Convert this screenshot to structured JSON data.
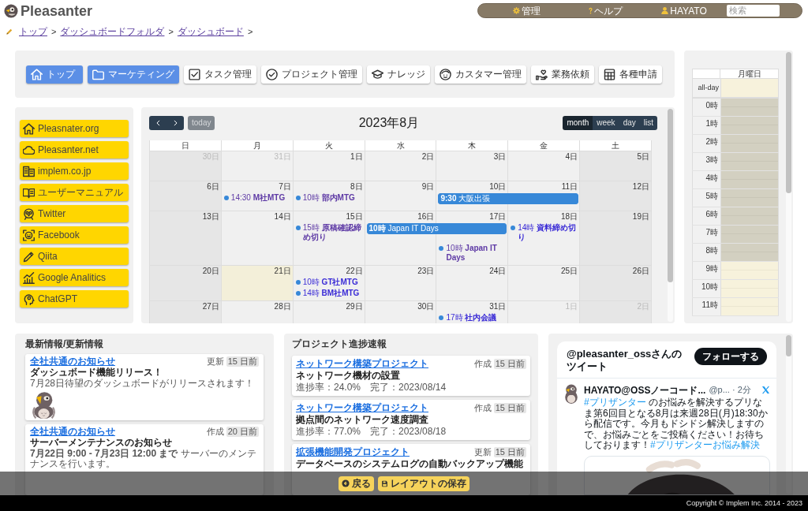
{
  "header": {
    "logo": "Pleasanter",
    "menu": [
      {
        "kind": "admin",
        "label": "管理"
      },
      {
        "kind": "help",
        "label": "ヘルプ"
      },
      {
        "kind": "user",
        "label": "HAYATO"
      }
    ],
    "search": {
      "placeholder": "検索"
    }
  },
  "breadcrumb": [
    {
      "label": "トップ",
      "separator": ">"
    },
    {
      "label": "ダッシュボードフォルダ",
      "separator": ">"
    },
    {
      "label": "ダッシュボード",
      "separator": ">"
    }
  ],
  "nav_buttons": [
    {
      "kind": "home",
      "label": "トップ",
      "highlighted": true
    },
    {
      "kind": "folder",
      "label": "マーケティング",
      "highlighted": true
    },
    {
      "kind": "task",
      "label": "タスク管理",
      "highlighted": false
    },
    {
      "kind": "project",
      "label": "プロジェクト管理",
      "highlighted": false
    },
    {
      "kind": "knowledge",
      "label": "ナレッジ",
      "highlighted": false
    },
    {
      "kind": "customer",
      "label": "カスタマー管理",
      "highlighted": false
    },
    {
      "kind": "request",
      "label": "業務依頼",
      "highlighted": false
    },
    {
      "kind": "application",
      "label": "各種申請",
      "highlighted": false
    }
  ],
  "quick_links": [
    {
      "kind": "home",
      "label": "Pleasnater.org"
    },
    {
      "kind": "cloud",
      "label": "Pleasanter.net"
    },
    {
      "kind": "company",
      "label": "implem.co.jp"
    },
    {
      "kind": "manual",
      "label": "ユーザーマニュアル"
    },
    {
      "kind": "twitter",
      "label": "Twitter"
    },
    {
      "kind": "facebook",
      "label": "Facebook"
    },
    {
      "kind": "qiita",
      "label": "Qiita"
    },
    {
      "kind": "analytics",
      "label": "Google Analitics"
    },
    {
      "kind": "chatgpt",
      "label": "ChatGPT"
    }
  ],
  "calendar": {
    "today_button": {
      "label": "today",
      "disabled": true
    },
    "title": "2023年8月",
    "views": [
      {
        "label": "month",
        "selected": true
      },
      {
        "label": "week",
        "selected": false
      },
      {
        "label": "day",
        "selected": false
      },
      {
        "label": "list",
        "selected": false
      }
    ],
    "weekdays": [
      "日",
      "月",
      "火",
      "水",
      "木",
      "金",
      "土"
    ],
    "weeks": [
      {
        "days": [
          {
            "date": "30日",
            "other_month": true,
            "today": false
          },
          {
            "date": "31日",
            "other_month": true,
            "today": false
          },
          {
            "date": "1日",
            "other_month": false,
            "today": false
          },
          {
            "date": "2日",
            "other_month": false,
            "today": false
          },
          {
            "date": "3日",
            "other_month": false,
            "today": false
          },
          {
            "date": "4日",
            "other_month": false,
            "today": false
          },
          {
            "date": "5日",
            "other_month": false,
            "today": false
          }
        ]
      },
      {
        "days": [
          {
            "date": "6日",
            "other_month": false,
            "today": false
          },
          {
            "date": "7日",
            "other_month": false,
            "today": false,
            "events": [
              {
                "kind": "dot",
                "label": "14:30 **M社MTG**",
                "visited": true
              }
            ]
          },
          {
            "date": "8日",
            "other_month": false,
            "today": false,
            "events": [
              {
                "kind": "dot",
                "label": "10時 **部内MTG**",
                "visited": true
              }
            ]
          },
          {
            "date": "9日",
            "other_month": false,
            "today": false
          },
          {
            "date": "10日",
            "other_month": false,
            "today": false,
            "events": [
              {
                "kind": "bar",
                "label": "**9:30** 大阪出張",
                "continues_next_day": true
              }
            ]
          },
          {
            "date": "11日",
            "other_month": false,
            "today": false
          },
          {
            "date": "12日",
            "other_month": false,
            "today": false
          }
        ]
      },
      {
        "days": [
          {
            "date": "13日",
            "other_month": false,
            "today": false
          },
          {
            "date": "14日",
            "other_month": false,
            "today": false
          },
          {
            "date": "15日",
            "other_month": false,
            "today": false,
            "events": [
              {
                "kind": "dot",
                "label": "15時 **原稿確認締め切り**",
                "visited": true
              }
            ]
          },
          {
            "date": "16日",
            "other_month": false,
            "today": false,
            "events": [
              {
                "kind": "bar",
                "label": "**10時** Japan IT Days",
                "continues_next_day": true
              }
            ]
          },
          {
            "date": "17日",
            "other_month": false,
            "today": false,
            "events": [
              {
                "kind": "dot",
                "label": "10時 **Japan IT Days**",
                "visited": true
              }
            ]
          },
          {
            "date": "18日",
            "other_month": false,
            "today": false,
            "events": [
              {
                "kind": "dot",
                "label": "14時 **資料締め切り**",
                "visited": false
              }
            ]
          },
          {
            "date": "19日",
            "other_month": false,
            "today": false
          }
        ]
      },
      {
        "days": [
          {
            "date": "20日",
            "other_month": false,
            "today": false
          },
          {
            "date": "21日",
            "other_month": false,
            "today": true
          },
          {
            "date": "22日",
            "other_month": false,
            "today": false,
            "events": [
              {
                "kind": "dot",
                "label": "10時 **GT社MTG**",
                "visited": false
              },
              {
                "kind": "dot",
                "label": "14時 **BM社MTG**",
                "visited": false
              }
            ]
          },
          {
            "date": "23日",
            "other_month": false,
            "today": false
          },
          {
            "date": "24日",
            "other_month": false,
            "today": false
          },
          {
            "date": "25日",
            "other_month": false,
            "today": false
          },
          {
            "date": "26日",
            "other_month": false,
            "today": false
          }
        ]
      },
      {
        "days": [
          {
            "date": "27日",
            "other_month": false,
            "today": false
          },
          {
            "date": "28日",
            "other_month": false,
            "today": false
          },
          {
            "date": "29日",
            "other_month": false,
            "today": false
          },
          {
            "date": "30日",
            "other_month": false,
            "today": false
          },
          {
            "date": "31日",
            "other_month": false,
            "today": false,
            "events": [
              {
                "kind": "dot",
                "label": "17時 **社内会議**",
                "visited": false
              }
            ]
          },
          {
            "date": "1日",
            "other_month": true,
            "today": false
          },
          {
            "date": "2日",
            "other_month": true,
            "today": false
          }
        ]
      }
    ]
  },
  "week_view": {
    "column": "月曜日",
    "all_day_label": "all-day",
    "hours": [
      {
        "label": "0時",
        "business_hours": false
      },
      {
        "label": "1時",
        "business_hours": false
      },
      {
        "label": "2時",
        "business_hours": false
      },
      {
        "label": "3時",
        "business_hours": false
      },
      {
        "label": "4時",
        "business_hours": false
      },
      {
        "label": "5時",
        "business_hours": false
      },
      {
        "label": "6時",
        "business_hours": false
      },
      {
        "label": "7時",
        "business_hours": false
      },
      {
        "label": "8時",
        "business_hours": false
      },
      {
        "label": "9時",
        "business_hours": true
      },
      {
        "label": "10時",
        "business_hours": true
      },
      {
        "label": "11時",
        "business_hours": true
      }
    ]
  },
  "news": {
    "title": "最新情報/更新情報",
    "items": [
      {
        "category": "全社共通のお知らせ",
        "meta_label": "更新",
        "age": "15 日前",
        "title": "ダッシュボード機能リリース！",
        "body": "7月28日待望のダッシュボードがリリースされます！",
        "image": true
      },
      {
        "category": "全社共通のお知らせ",
        "meta_label": "作成",
        "age": "20 日前",
        "title": "サーバーメンテナンスのお知らせ",
        "body": "**7月22日 9:00 - 7月23日 12:00 まで** サーバーのメンテナンスを行います。"
      }
    ]
  },
  "progress": {
    "title": "プロジェクト進捗速報",
    "items": [
      {
        "project": "ネットワーク構築プロジェクト",
        "meta_label": "作成",
        "age": "15 日前",
        "title": "ネットワーク機材の設置",
        "status": "進捗率：24.0%　完了：2023/08/14"
      },
      {
        "project": "ネットワーク構築プロジェクト",
        "meta_label": "作成",
        "age": "15 日前",
        "title": "拠点間のネットワーク速度調査",
        "status": "進捗率：77.0%　完了：2023/08/18"
      },
      {
        "project": "拡張機能開発プロジェクト",
        "meta_label": "更新",
        "age": "15 日前",
        "title": "データベースのシステムログの自動バックアップ機能"
      }
    ]
  },
  "twitter": {
    "title": "@pleasanter_ossさんのツイート",
    "follow_button": "フォローする",
    "tweets": [
      {
        "author": "HAYATO@OSSノーコード...",
        "handle": "@p... · 2分",
        "text": [
          {
            "kind": "hashtag",
            "text": "#プリザンター"
          },
          {
            "kind": "text",
            "text": " のお悩みを解決するプリなま第6回目となる8月は来週28日(月)18:30から配信です。今月もドシドシ解決しますので、お悩みごとをご投稿ください！お待ちしております！"
          },
          {
            "kind": "hashtag",
            "text": "#プリザンターお悩み解決"
          }
        ],
        "image": true
      }
    ]
  },
  "layout_bar": {
    "buttons": [
      {
        "kind": "back",
        "label": "戻る"
      },
      {
        "kind": "save",
        "label": "レイアウトの保存"
      }
    ]
  },
  "footer": {
    "copyright": "Copyright © Implem Inc. 2014 - 2023"
  }
}
